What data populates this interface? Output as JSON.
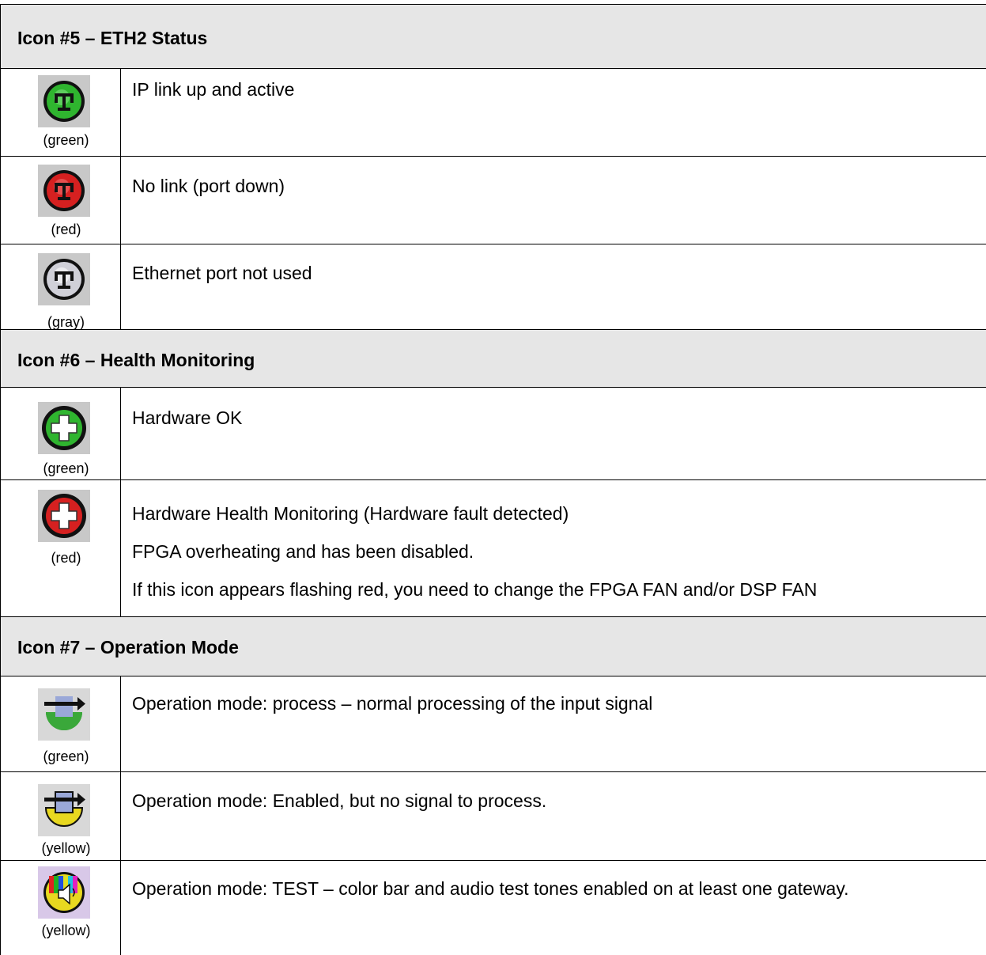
{
  "sections": [
    {
      "header": "Icon #5 – ETH2 Status",
      "rows": [
        {
          "icon": "network-status-icon",
          "color": "#2fb52f",
          "caption": "(green)",
          "lines": [
            "IP link up and active"
          ]
        },
        {
          "icon": "network-status-icon",
          "color": "#d62020",
          "caption": "(red)",
          "lines": [
            "No link (port down)"
          ]
        },
        {
          "icon": "network-status-icon",
          "color": "#d0d0d8",
          "caption": "(gray)",
          "lines": [
            "Ethernet port not used"
          ]
        }
      ]
    },
    {
      "header": "Icon #6 – Health Monitoring",
      "rows": [
        {
          "icon": "health-cross-icon",
          "color": "#2fb52f",
          "caption": "(green)",
          "lines": [
            "Hardware OK"
          ]
        },
        {
          "icon": "health-cross-icon",
          "color": "#d62020",
          "caption": "(red)",
          "lines": [
            "Hardware Health Monitoring (Hardware fault detected)",
            "FPGA overheating and has been disabled.",
            "If this icon appears flashing red, you need to change the FPGA FAN and/or DSP FAN"
          ]
        }
      ]
    },
    {
      "header": "Icon #7 – Operation Mode",
      "rows": [
        {
          "icon": "operation-mode-icon",
          "color": "#3aa83a",
          "caption": "(green)",
          "lines": [
            "Operation mode:  process – normal processing of the input signal"
          ]
        },
        {
          "icon": "operation-mode-icon",
          "color": "#e8d820",
          "caption": "(yellow)",
          "lines": [
            "Operation mode: Enabled, but no signal to process."
          ]
        },
        {
          "icon": "test-mode-icon",
          "color": "#e8d820",
          "caption": "(yellow)",
          "lines": [
            "Operation mode: TEST – color bar and audio test tones enabled on at least one gateway."
          ]
        }
      ]
    }
  ]
}
